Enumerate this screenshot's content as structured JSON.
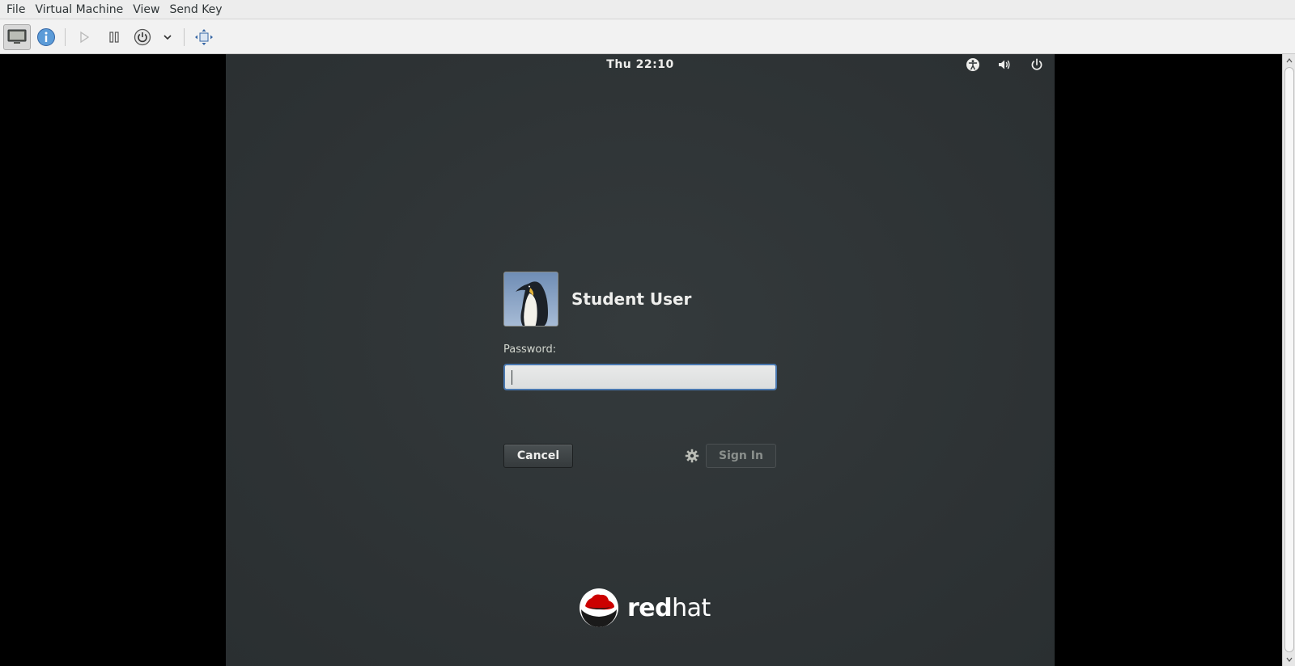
{
  "menubar": {
    "items": [
      "File",
      "Virtual Machine",
      "View",
      "Send Key"
    ]
  },
  "toolbar": {
    "buttons": [
      "console-icon",
      "details-icon",
      "run-icon",
      "pause-icon",
      "shutdown-icon",
      "shutdown-menu-chevron-icon",
      "fullscreen-icon"
    ]
  },
  "guest": {
    "clock": "Thu 22:10",
    "status_icons": [
      "accessibility-icon",
      "volume-icon",
      "power-icon"
    ],
    "user": {
      "name": "Student User",
      "avatar": "penguin-avatar"
    },
    "password": {
      "label": "Password:",
      "value": "",
      "placeholder": ""
    },
    "buttons": {
      "cancel": "Cancel",
      "sign_in": "Sign In"
    },
    "logo": {
      "text_bold": "red",
      "text_light": "hat",
      "colors": {
        "hat": "#cc0000",
        "text": "#ffffff"
      }
    }
  },
  "colors": {
    "guest_bg": "#2e3436",
    "focus_border": "#4a78b0"
  }
}
